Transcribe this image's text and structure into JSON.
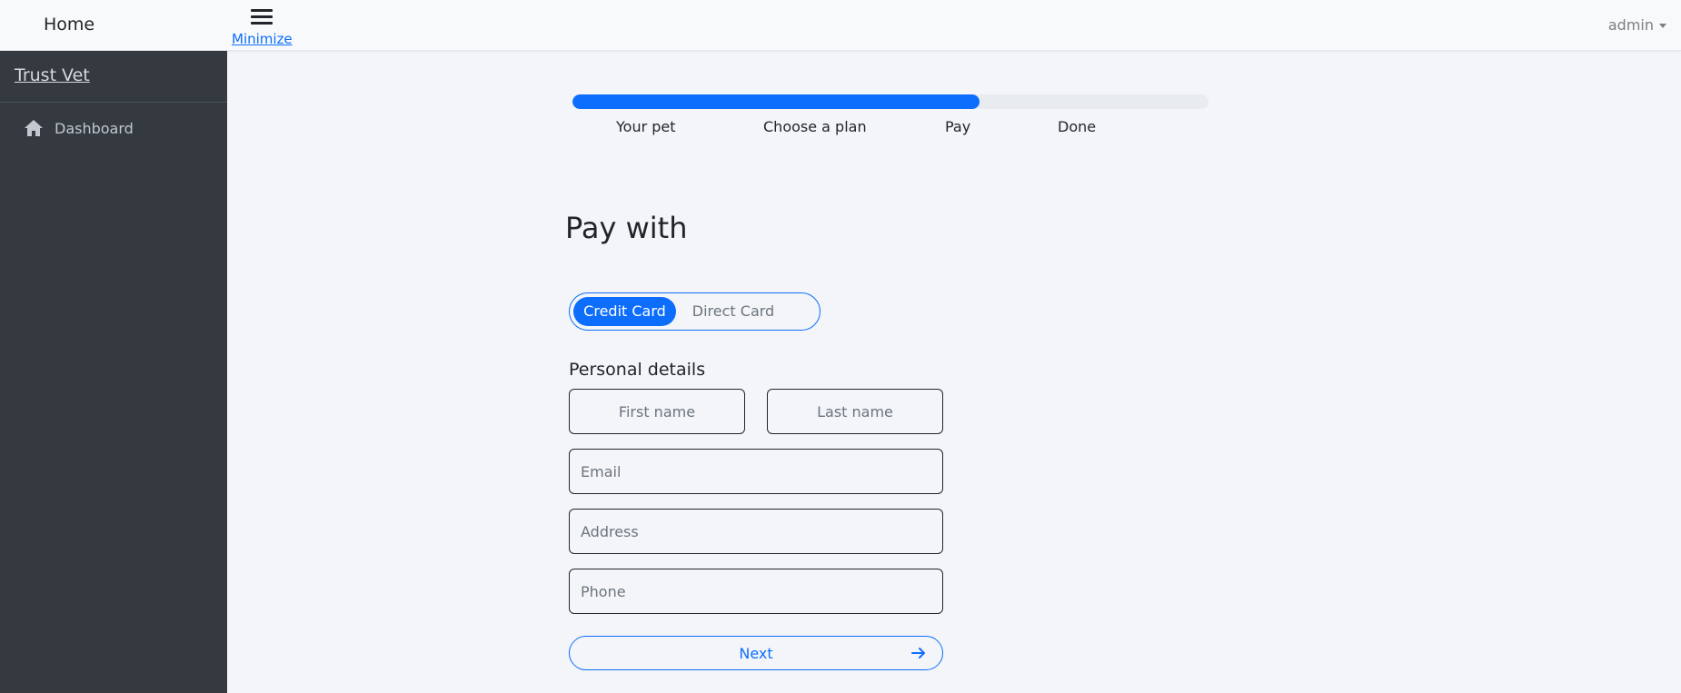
{
  "header": {
    "home_label": "Home",
    "minimize_label": "Minimize",
    "user_label": "admin"
  },
  "sidebar": {
    "brand": "Trust Vet",
    "items": [
      {
        "label": "Dashboard",
        "icon": "home-icon"
      }
    ]
  },
  "stepper": {
    "progress_percent": 64,
    "steps": [
      "Your pet",
      "Choose a plan",
      "Pay",
      "Done"
    ]
  },
  "payment": {
    "title": "Pay with",
    "options": [
      "Credit Card",
      "Direct Card"
    ],
    "selected": "Credit Card"
  },
  "form": {
    "section_title": "Personal details",
    "first_name": {
      "value": "",
      "placeholder": "First name"
    },
    "last_name": {
      "value": "",
      "placeholder": "Last name"
    },
    "email": {
      "value": "",
      "placeholder": "Email"
    },
    "address": {
      "value": "",
      "placeholder": "Address"
    },
    "phone": {
      "value": "",
      "placeholder": "Phone"
    },
    "next_label": "Next"
  },
  "colors": {
    "accent": "#0d6efd",
    "sidebar_bg": "#343a40",
    "page_bg": "#f3f5f9"
  }
}
